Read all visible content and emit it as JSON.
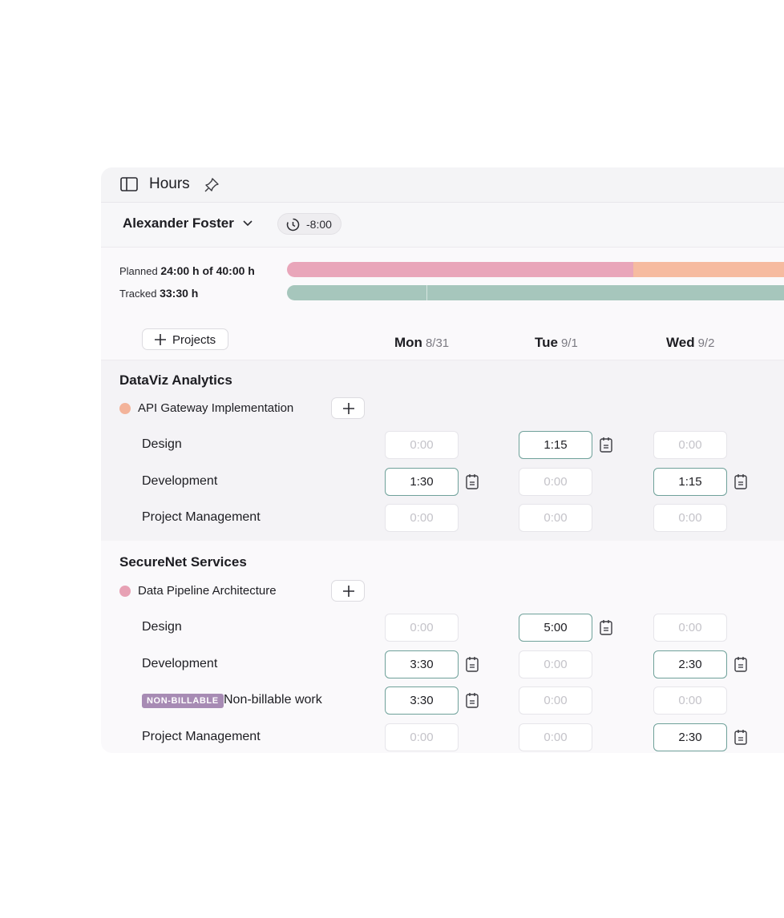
{
  "window": {
    "title": "Hours"
  },
  "user": {
    "name": "Alexander Foster",
    "timer": "-8:00"
  },
  "summary": {
    "planned_label": "Planned",
    "planned_value": "24:00 h of 40:00 h",
    "tracked_label": "Tracked",
    "tracked_value": "33:30 h",
    "planned_fraction": 0.6,
    "tracked_fraction": 0.84
  },
  "toolbar": {
    "projects_label": "Projects"
  },
  "days": [
    {
      "name": "Mon",
      "date": "8/31"
    },
    {
      "name": "Tue",
      "date": "9/1"
    },
    {
      "name": "Wed",
      "date": "9/2"
    }
  ],
  "groups": [
    {
      "client": "DataViz Analytics",
      "project": "API Gateway Implementation",
      "color": "#f3b39a",
      "tasks": [
        {
          "name": "Design",
          "hours": [
            "0:00",
            "1:15",
            "0:00"
          ]
        },
        {
          "name": "Development",
          "hours": [
            "1:30",
            "0:00",
            "1:15"
          ]
        },
        {
          "name": "Project Management",
          "hours": [
            "0:00",
            "0:00",
            "0:00"
          ]
        }
      ]
    },
    {
      "client": "SecureNet Services",
      "project": "Data Pipeline Architecture",
      "color": "#e7a1b4",
      "tasks": [
        {
          "name": "Design",
          "hours": [
            "0:00",
            "5:00",
            "0:00"
          ]
        },
        {
          "name": "Development",
          "hours": [
            "3:30",
            "0:00",
            "2:30"
          ]
        },
        {
          "name": "Non-billable work",
          "badge": "NON-BILLABLE",
          "hours": [
            "3:30",
            "0:00",
            "0:00"
          ]
        },
        {
          "name": "Project Management",
          "hours": [
            "0:00",
            "0:00",
            "2:30"
          ]
        }
      ]
    }
  ],
  "colors": {
    "planned_bar": "#e9a6ba",
    "planned_remaining": "#f6bba0",
    "tracked_bar": "#a6c6bc",
    "filled_border": "#6fa19a",
    "badge": "#a78bb4"
  }
}
